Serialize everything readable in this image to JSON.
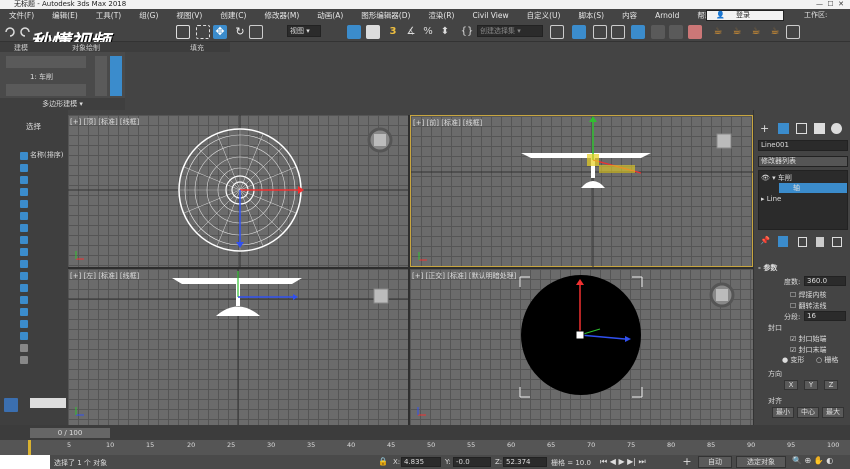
{
  "titlebar": {
    "title": "无标题 - Autodesk 3ds Max 2018"
  },
  "menu": [
    "文件(F)",
    "编辑(E)",
    "工具(T)",
    "组(G)",
    "视图(V)",
    "创建(C)",
    "修改器(M)",
    "动画(A)",
    "图形编辑器(D)",
    "渲染(R)",
    "Civil View",
    "自定义(U)",
    "脚本(S)",
    "内容",
    "Arnold",
    "帮助(H)"
  ],
  "login": {
    "label": "登录",
    "workspace": "工作区:"
  },
  "toolbar": {
    "view_dropdown": "视图",
    "selection_set": "创建选择集"
  },
  "watermark": "秒懂视频",
  "ribbon": {
    "tabs": [
      "建模",
      "对象绘制",
      "填充"
    ],
    "subtab": "1: 车削",
    "poly_label": "多边形建模"
  },
  "leftpanel": {
    "select_label": "选择",
    "name_label": "名称(排序)"
  },
  "viewports": {
    "top": "[+] [顶] [标准] [线框]",
    "front": "[+] [前] [标准] [线框]",
    "left": "[+] [左] [标准] [线框]",
    "persp": "[+] [正交] [标准] [默认明暗处理]"
  },
  "rightpanel": {
    "object_name": "Line001",
    "modifier_list": "修改器列表",
    "stack": [
      "车削",
      "轴",
      "Line"
    ],
    "params_title": "参数",
    "degrees_label": "度数:",
    "degrees_value": "360.0",
    "weld_core": "焊接内核",
    "flip_normals": "翻转法线",
    "segments_label": "分段:",
    "segments_value": "16",
    "capping_title": "封口",
    "cap_start": "封口始端",
    "cap_end": "封口末端",
    "morph": "变形",
    "grid": "栅格",
    "direction_title": "方向",
    "dir_buttons": [
      "X",
      "Y",
      "Z"
    ],
    "align_title": "对齐",
    "align_buttons": [
      "最小",
      "中心",
      "最大"
    ],
    "accent": "#3b8ccc"
  },
  "timeline": {
    "frame": "0 / 100",
    "ticks": [
      "0",
      "5",
      "10",
      "15",
      "20",
      "25",
      "30",
      "35",
      "40",
      "45",
      "50",
      "55",
      "60",
      "65",
      "70",
      "75",
      "80",
      "85",
      "90",
      "95",
      "100"
    ]
  },
  "status": {
    "selected": "选择了 1 个 对象",
    "x_label": "X:",
    "x_value": "4.835",
    "y_label": "Y:",
    "y_value": "-0.0",
    "z_label": "Z:",
    "z_value": "52.374",
    "grid_label": "栅格 = 10.0",
    "auto": "自动",
    "set_key": "选定对象"
  }
}
